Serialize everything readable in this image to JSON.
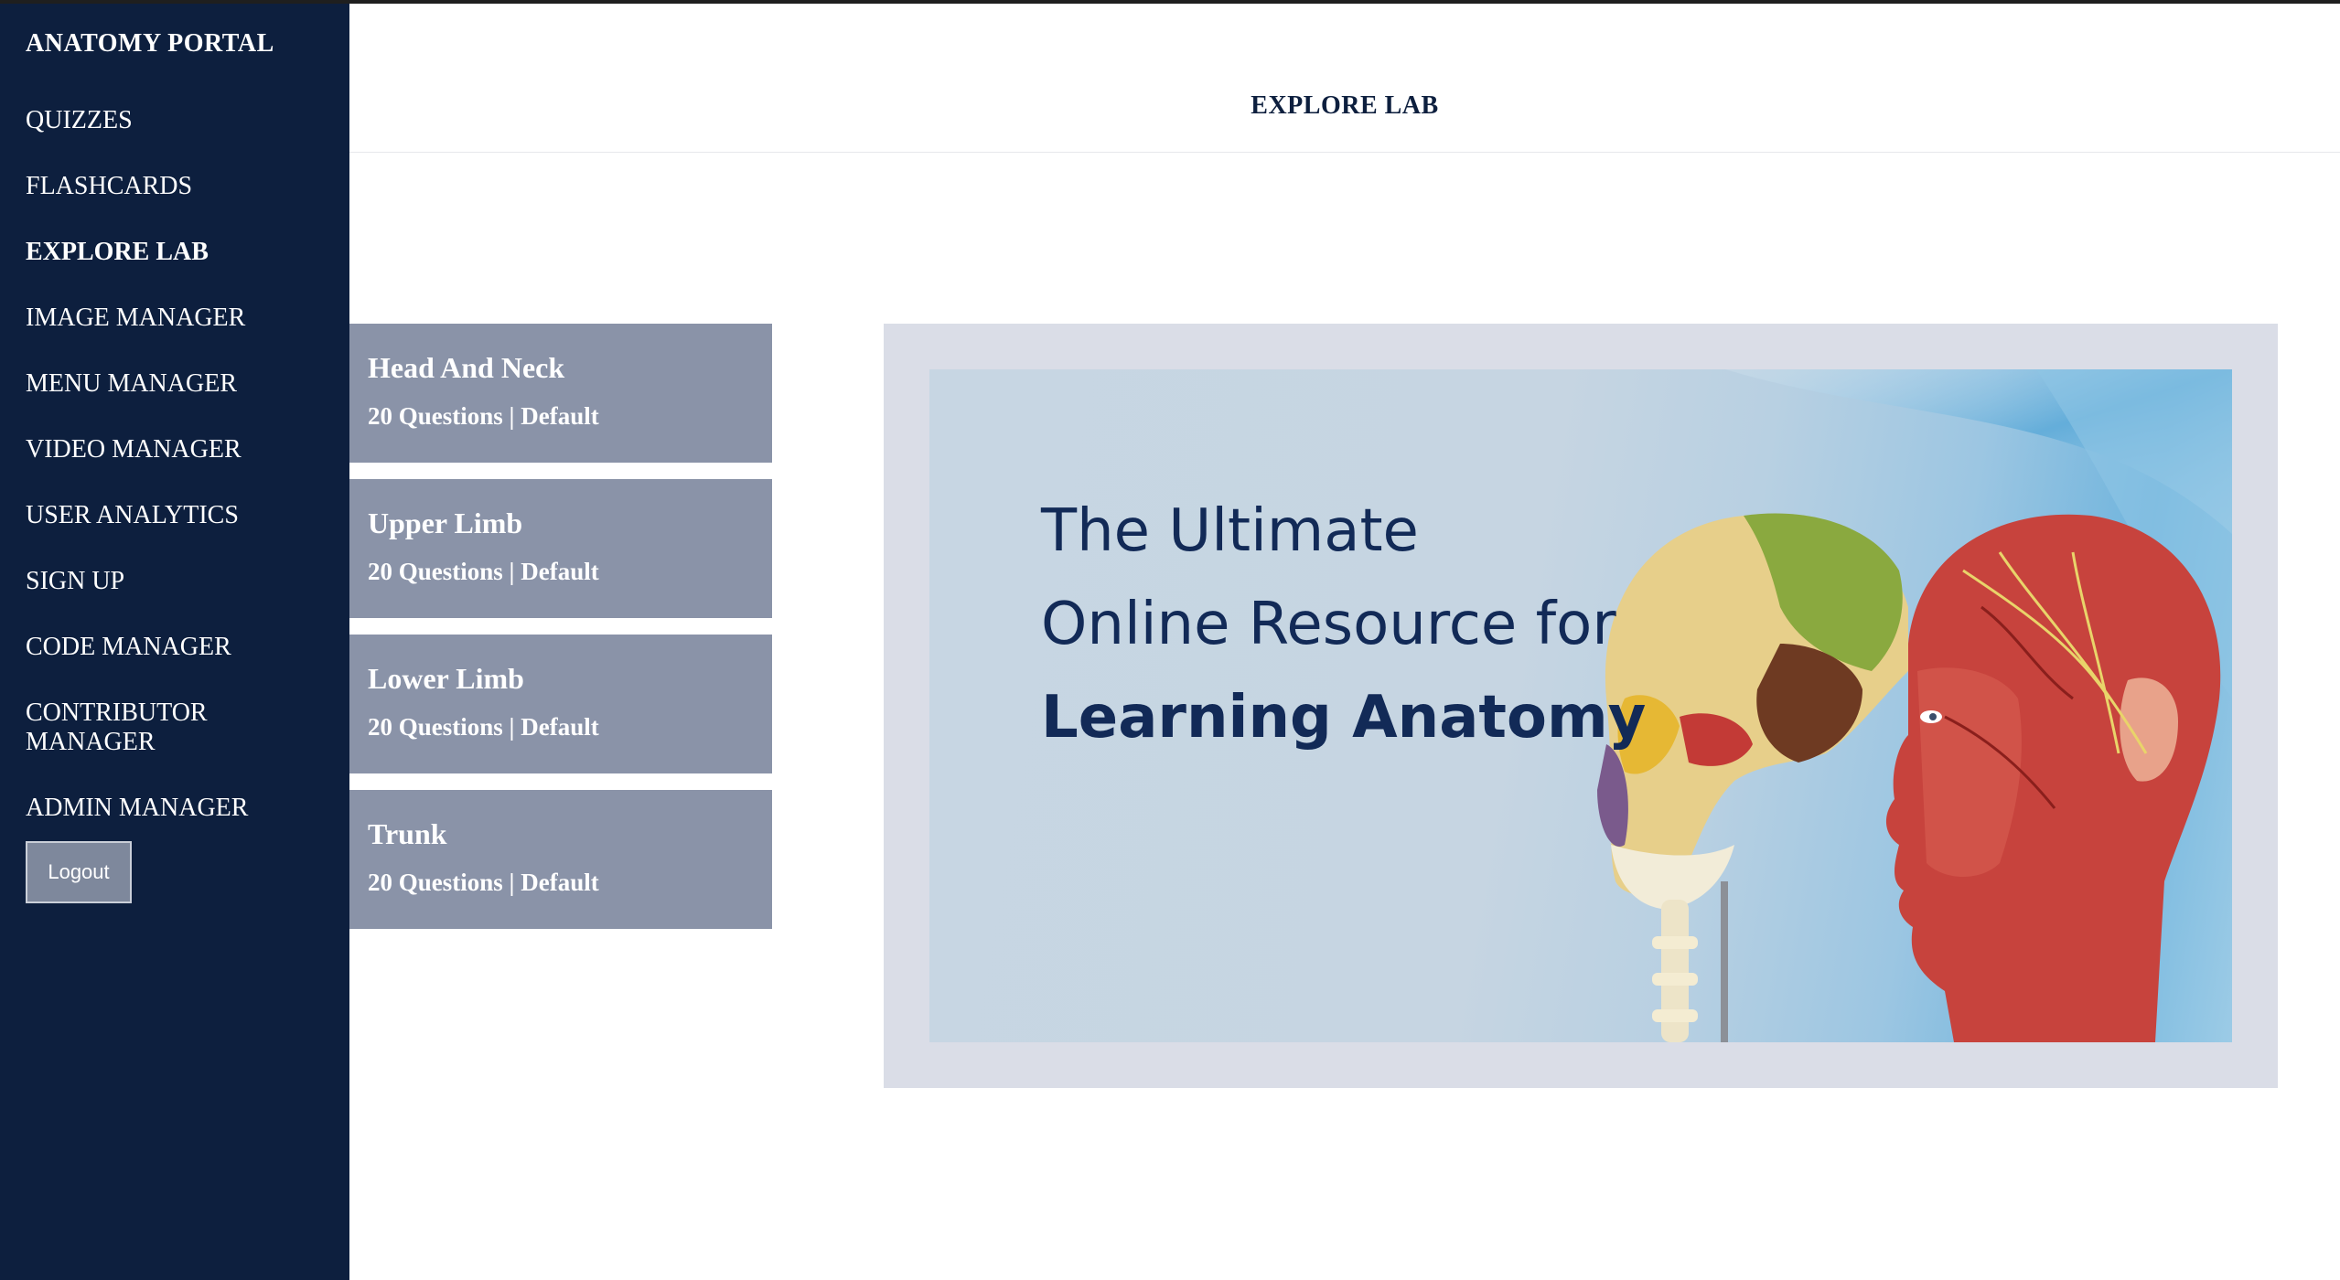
{
  "sidebar": {
    "brand": "ANATOMY PORTAL",
    "items": [
      {
        "label": "QUIZZES"
      },
      {
        "label": "FLASHCARDS"
      },
      {
        "label": "EXPLORE LAB",
        "active": true
      },
      {
        "label": "IMAGE MANAGER"
      },
      {
        "label": "MENU MANAGER"
      },
      {
        "label": "VIDEO MANAGER"
      },
      {
        "label": "USER ANALYTICS"
      },
      {
        "label": "SIGN UP"
      },
      {
        "label": "CODE MANAGER"
      },
      {
        "label": "CONTRIBUTOR MANAGER"
      },
      {
        "label": "ADMIN MANAGER"
      }
    ],
    "logout_label": "Logout"
  },
  "header": {
    "title": "EXPLORE LAB"
  },
  "regions": [
    {
      "title": "Head And Neck",
      "meta": "20 Questions | Default"
    },
    {
      "title": "Upper Limb",
      "meta": "20 Questions | Default"
    },
    {
      "title": "Lower Limb",
      "meta": "20 Questions | Default"
    },
    {
      "title": "Trunk",
      "meta": "20 Questions | Default"
    }
  ],
  "banner": {
    "line1": "The Ultimate",
    "line2": "Online Resource for",
    "line3": "Learning Anatomy"
  },
  "colors": {
    "sidebar_bg": "#0d1f3e",
    "card_bg": "#8a93a8",
    "banner_frame": "#dadde7",
    "banner_text": "#122a57"
  }
}
